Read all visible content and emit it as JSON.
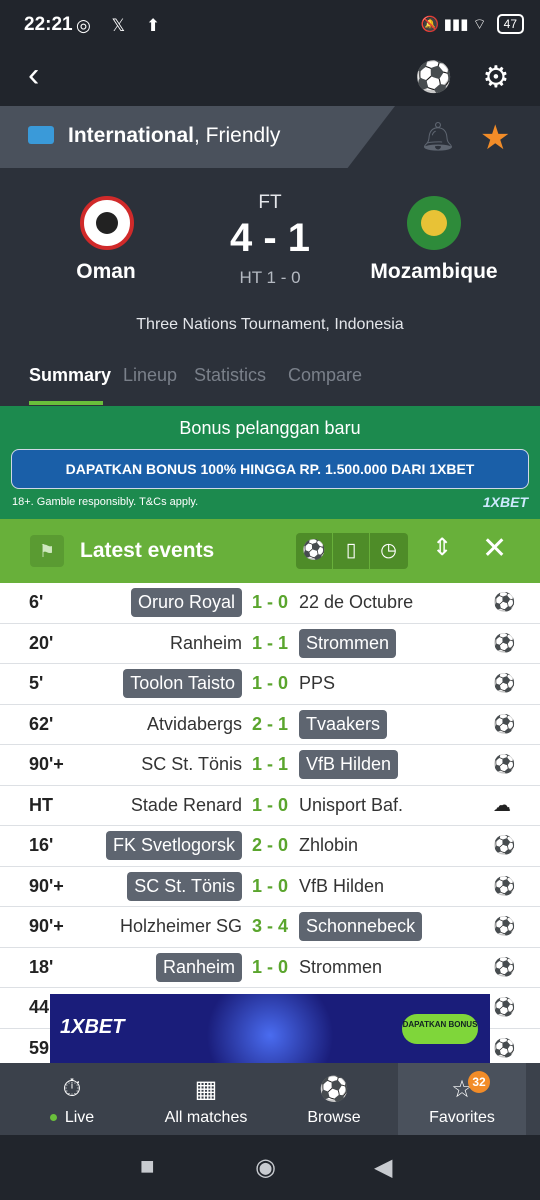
{
  "status_bar": {
    "time": "22:21",
    "left_icons": "◎ 𝕏 ⬆",
    "right_icons": "🔕 ▮▮▮ ⌔",
    "battery": "47"
  },
  "toolbar": {
    "back_icon": "back-arrow-icon",
    "info_icon": "ball-info-icon",
    "settings_icon": "gear-icon"
  },
  "league": {
    "name": "International",
    "subtitle": ", Friendly",
    "flag_icon": "globe-flag-icon"
  },
  "match": {
    "status": "FT",
    "score": "4 - 1",
    "halftime": "HT 1 - 0",
    "home": "Oman",
    "away": "Mozambique",
    "tournament": "Three Nations Tournament, Indonesia"
  },
  "tabs": [
    {
      "label": "Summary"
    },
    {
      "label": "Lineup"
    },
    {
      "label": "Statistics"
    },
    {
      "label": "Compare"
    }
  ],
  "promo": {
    "title": "Bonus pelanggan baru",
    "button": "DAPATKAN BONUS 100% HINGGA RP. 1.500.000 DARI 1XBET",
    "disclaimer": "18+. Gamble responsibly. T&Cs apply.",
    "brand": "1XBET"
  },
  "events_header": {
    "title": "Latest events"
  },
  "events": [
    {
      "minute": "6'",
      "home": "Oruro Royal",
      "score": "1 - 0",
      "away": "22 de Octubre",
      "hl": "home",
      "icon": "⚽"
    },
    {
      "minute": "20'",
      "home": "Ranheim",
      "score": "1 - 1",
      "away": "Strommen",
      "hl": "away",
      "icon": "⚽"
    },
    {
      "minute": "5'",
      "home": "Toolon Taisto",
      "score": "1 - 0",
      "away": "PPS",
      "hl": "home",
      "icon": "⚽"
    },
    {
      "minute": "62'",
      "home": "Atvidabergs",
      "score": "2 - 1",
      "away": "Tvaakers",
      "hl": "away",
      "icon": "⚽"
    },
    {
      "minute": "90'+",
      "home": "SC St. Tönis",
      "score": "1 - 1",
      "away": "VfB Hilden",
      "hl": "away",
      "icon": "⚽"
    },
    {
      "minute": "HT",
      "home": "Stade Renard",
      "score": "1 - 0",
      "away": "Unisport Baf.",
      "hl": "none",
      "icon": "☁"
    },
    {
      "minute": "16'",
      "home": "FK Svetlogorsk",
      "score": "2 - 0",
      "away": "Zhlobin",
      "hl": "home",
      "icon": "⚽"
    },
    {
      "minute": "90'+",
      "home": "SC St. Tönis",
      "score": "1 - 0",
      "away": "VfB Hilden",
      "hl": "home",
      "icon": "⚽"
    },
    {
      "minute": "90'+",
      "home": "Holzheimer SG",
      "score": "3 - 4",
      "away": "Schonnebeck",
      "hl": "away",
      "icon": "⚽"
    },
    {
      "minute": "18'",
      "home": "Ranheim",
      "score": "1 - 0",
      "away": "Strommen",
      "hl": "home",
      "icon": "⚽"
    },
    {
      "minute": "44",
      "home": "",
      "score": "",
      "away": "",
      "hl": "none",
      "icon": "⚽"
    },
    {
      "minute": "59",
      "home": "",
      "score": "",
      "away": "",
      "hl": "none",
      "icon": "⚽"
    }
  ],
  "ad": {
    "brand": "1XBET",
    "cta": "DAPATKAN BONUS"
  },
  "bottom_nav": [
    {
      "label": "Live",
      "icon": "⏱"
    },
    {
      "label": "All matches",
      "icon": "▦"
    },
    {
      "label": "Browse",
      "icon": "⚽"
    },
    {
      "label": "Favorites",
      "icon": "☆",
      "badge": "32"
    }
  ],
  "colors": {
    "accent_green": "#68b03a",
    "star_orange": "#f28c28",
    "promo_green": "#1c8a4e"
  }
}
